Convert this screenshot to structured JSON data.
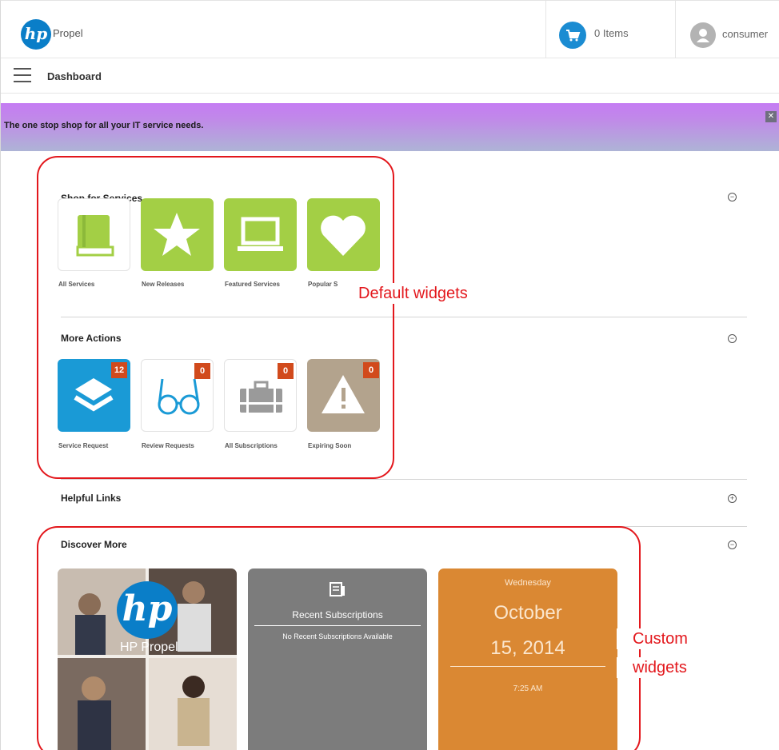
{
  "header": {
    "logo_text": "hp",
    "brand": "Propel",
    "cart_label": "0 Items",
    "user_name": "consumer"
  },
  "nav": {
    "title": "Dashboard"
  },
  "banner": {
    "text": "The one stop shop for all your IT service needs."
  },
  "shop": {
    "title": "Shop for Services",
    "tiles": [
      {
        "label": "All Services",
        "icon": "book-icon",
        "color": "#a3cf45"
      },
      {
        "label": "New Releases",
        "icon": "star-icon",
        "color": "#a3cf45"
      },
      {
        "label": "Featured Services",
        "icon": "laptop-icon",
        "color": "#a3cf45"
      },
      {
        "label": "Popular S",
        "icon": "heart-icon",
        "color": "#a3cf45"
      }
    ]
  },
  "actions": {
    "title": "More Actions",
    "tiles": [
      {
        "label": "Service Request",
        "icon": "layers-icon",
        "badge": "12"
      },
      {
        "label": "Review Requests",
        "icon": "glasses-icon",
        "badge": "0"
      },
      {
        "label": "All Subscriptions",
        "icon": "briefcase-icon",
        "badge": "0"
      },
      {
        "label": "Expiring Soon",
        "icon": "warning-icon",
        "badge": "0"
      }
    ]
  },
  "helpful": {
    "title": "Helpful Links"
  },
  "discover": {
    "title": "Discover More",
    "promo_caption": "HP Propel",
    "recent": {
      "title": "Recent Subscriptions",
      "empty": "No Recent Subscriptions Available"
    },
    "date": {
      "weekday": "Wednesday",
      "month": "October",
      "day_year": "15, 2014",
      "time": "7:25 AM"
    }
  },
  "annotations": {
    "default": "Default widgets",
    "custom_line1": "Custom",
    "custom_line2": "widgets"
  },
  "colors": {
    "accent_blue": "#1b8cd2",
    "tile_green": "#a3cf45",
    "request_blue": "#1a9ad6",
    "expiring_tan": "#b3a38d",
    "badge_red": "#d14a1c",
    "recent_gray": "#7c7c7c",
    "date_orange": "#da8833",
    "annotation_red": "#e3171c"
  }
}
